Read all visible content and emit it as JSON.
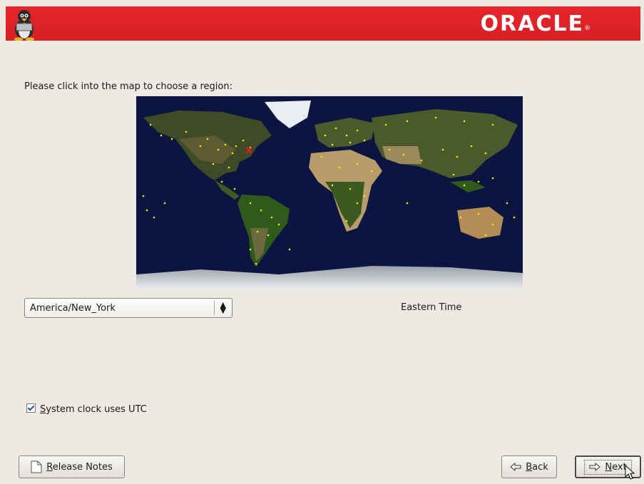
{
  "header": {
    "logo_text": "ORACLE",
    "logo_mark": "®",
    "mascot_icon": "tux-penguin-icon",
    "background_color": "#d9232a"
  },
  "timezone": {
    "prompt": "Please click into the map to choose a region:",
    "selected_zone": "America/New_York",
    "zone_description": "Eastern Time",
    "map": {
      "ocean_color": "#0b1540",
      "city_marker_color": "#f5f000",
      "selected_marker_color": "#e02020"
    }
  },
  "clock": {
    "utc_mnemonic": "S",
    "utc_label_rest": "ystem clock uses UTC",
    "utc_checked": true
  },
  "buttons": {
    "release_notes": {
      "mnemonic": "R",
      "rest": "elease Notes",
      "icon": "document-icon"
    },
    "back": {
      "mnemonic": "B",
      "rest": "ack",
      "icon": "arrow-left-icon"
    },
    "next": {
      "mnemonic": "N",
      "rest": "ext",
      "icon": "arrow-right-icon"
    }
  }
}
